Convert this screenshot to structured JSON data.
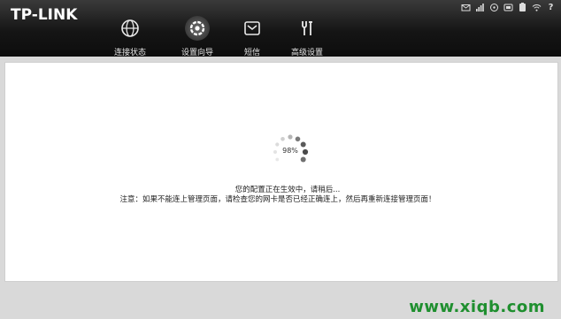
{
  "header": {
    "logo": "TP-LINK",
    "nav": [
      {
        "label": "连接状态",
        "icon": "globe-icon"
      },
      {
        "label": "设置向导",
        "icon": "wizard-icon"
      },
      {
        "label": "短信",
        "icon": "envelope-icon"
      },
      {
        "label": "高级设置",
        "icon": "tools-icon"
      }
    ],
    "active_nav": "设置向导",
    "status_icons": [
      "mail-icon",
      "signal-icon",
      "roaming-icon",
      "sim-icon",
      "battery-icon",
      "wifi-icon",
      "help-icon"
    ],
    "help_glyph": "?"
  },
  "main": {
    "progress": {
      "percent_label": "98%",
      "value": 0.98
    },
    "message": "您的配置正在生效中，请稍后...",
    "notice": "注意：如果不能连上管理页面，请检查您的网卡是否已经正确连上，然后再重新连接管理页面！"
  },
  "watermark": "www.xiqb.com",
  "colors": {
    "topbar": "#141414",
    "content_bg": "#ffffff",
    "page_bg": "#d9d9d9",
    "watermark": "#1f8f2f"
  }
}
